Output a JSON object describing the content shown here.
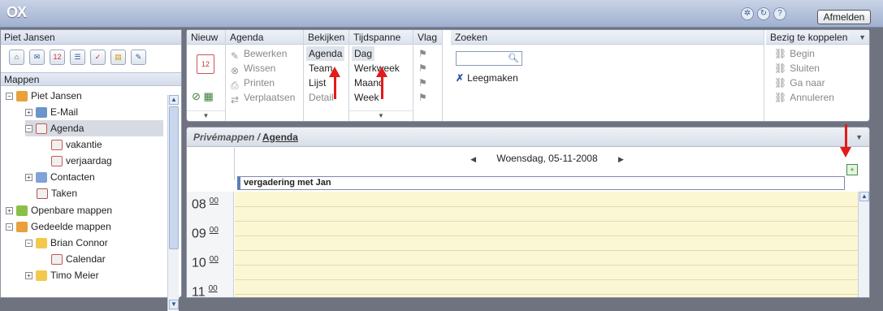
{
  "topbar": {
    "logo": "OX",
    "logout_label": "Afmelden"
  },
  "left": {
    "user_name": "Piet Jansen",
    "mappen_label": "Mappen",
    "tree": [
      {
        "label": "Piet Jansen"
      },
      {
        "label": "E-Mail"
      },
      {
        "label": "Agenda"
      },
      {
        "label": "vakantie"
      },
      {
        "label": "verjaardag"
      },
      {
        "label": "Contacten"
      },
      {
        "label": "Taken"
      },
      {
        "label": "Openbare mappen"
      },
      {
        "label": "Gedeelde mappen"
      },
      {
        "label": "Brian Connor"
      },
      {
        "label": "Calendar"
      },
      {
        "label": "Timo Meier"
      }
    ]
  },
  "ribbon": {
    "nieuw": "Nieuw",
    "agenda_group": "Agenda",
    "bewerken": "Bewerken",
    "wissen": "Wissen",
    "printen": "Printen",
    "verplaatsen": "Verplaatsen",
    "bekijken_group": "Bekijken",
    "bekijken_agenda": "Agenda",
    "team": "Team",
    "lijst": "Lijst",
    "detail": "Detail",
    "tijdspanne_group": "Tijdspanne",
    "dag": "Dag",
    "werkweek": "Werkweek",
    "maand": "Maand",
    "week": "Week",
    "vlag_group": "Vlag",
    "zoeken_group": "Zoeken",
    "leegmaken": "Leegmaken",
    "koppelen_group": "Bezig te koppelen",
    "begin": "Begin",
    "sluiten": "Sluiten",
    "ga_naar": "Ga naar",
    "annuleren": "Annuleren"
  },
  "calendar": {
    "breadcrumb_prefix": "Privémappen /",
    "breadcrumb_link": "Agenda",
    "date": "Woensdag, 05-11-2008",
    "appointment": "vergadering met Jan",
    "hours": [
      {
        "h": "08",
        "m": "00"
      },
      {
        "h": "09",
        "m": "00"
      },
      {
        "h": "10",
        "m": "00"
      },
      {
        "h": "11",
        "m": "00"
      }
    ]
  }
}
